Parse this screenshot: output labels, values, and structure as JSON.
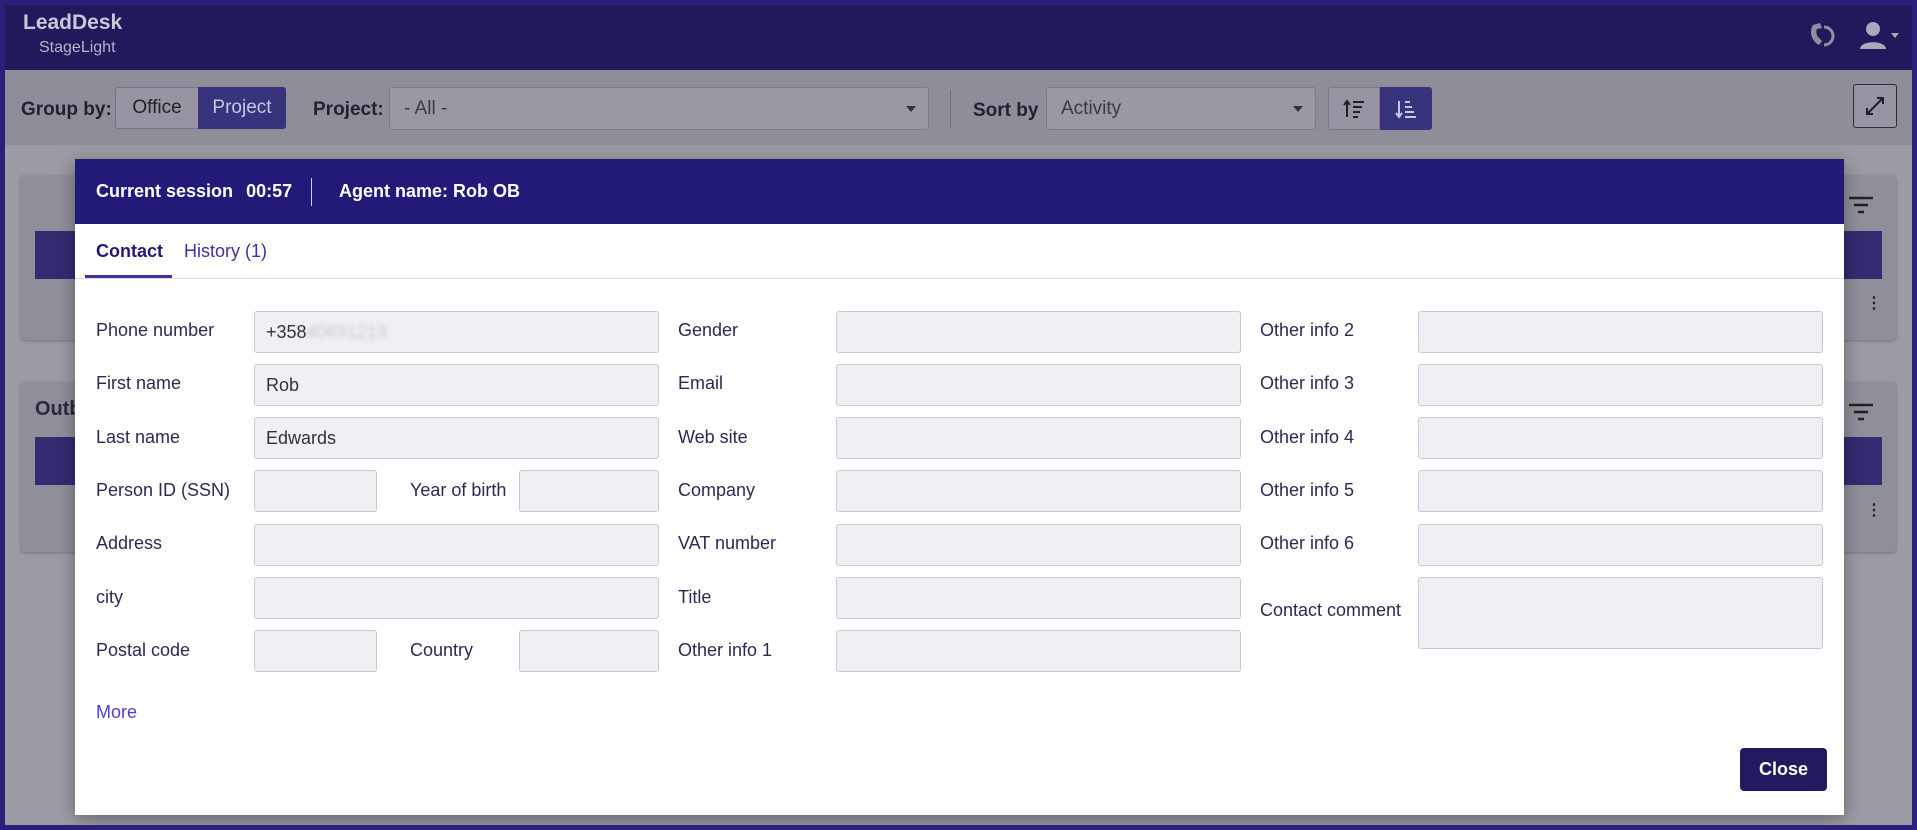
{
  "app": {
    "name": "LeadDesk",
    "subtitle": "StageLight"
  },
  "toolbar": {
    "group_by_label": "Group by:",
    "group_options": [
      "Office",
      "Project"
    ],
    "group_selected": "Project",
    "project_label": "Project:",
    "project_value": "- All -",
    "sort_label": "Sort by",
    "sort_value": "Activity"
  },
  "background": {
    "card2_title": "Outb"
  },
  "modal": {
    "session_label": "Current session",
    "session_time": "00:57",
    "agent": "Agent name: Rob OB",
    "tabs": [
      "Contact",
      "History (1)"
    ],
    "active_tab": "Contact",
    "fields": {
      "phone_label": "Phone number",
      "phone_visible": "+358",
      "phone_hidden": "40691213",
      "first_name_label": "First name",
      "first_name": "Rob",
      "last_name_label": "Last name",
      "last_name": "Edwards",
      "person_id_label": "Person ID (SSN)",
      "person_id": "",
      "year_of_birth_label": "Year of birth",
      "year_of_birth": "",
      "address_label": "Address",
      "address": "",
      "city_label": "city",
      "city": "",
      "postal_code_label": "Postal code",
      "postal_code": "",
      "country_label": "Country",
      "country": "",
      "gender_label": "Gender",
      "gender": "",
      "email_label": "Email",
      "email": "",
      "website_label": "Web site",
      "website": "",
      "company_label": "Company",
      "company": "",
      "vat_label": "VAT number",
      "vat": "",
      "title_label": "Title",
      "title": "",
      "other1_label": "Other info 1",
      "other1": "",
      "other2_label": "Other info 2",
      "other2": "",
      "other3_label": "Other info 3",
      "other3": "",
      "other4_label": "Other info 4",
      "other4": "",
      "other5_label": "Other info 5",
      "other5": "",
      "other6_label": "Other info 6",
      "other6": "",
      "comment_label": "Contact comment",
      "comment": ""
    },
    "more_label": "More",
    "close_label": "Close"
  }
}
